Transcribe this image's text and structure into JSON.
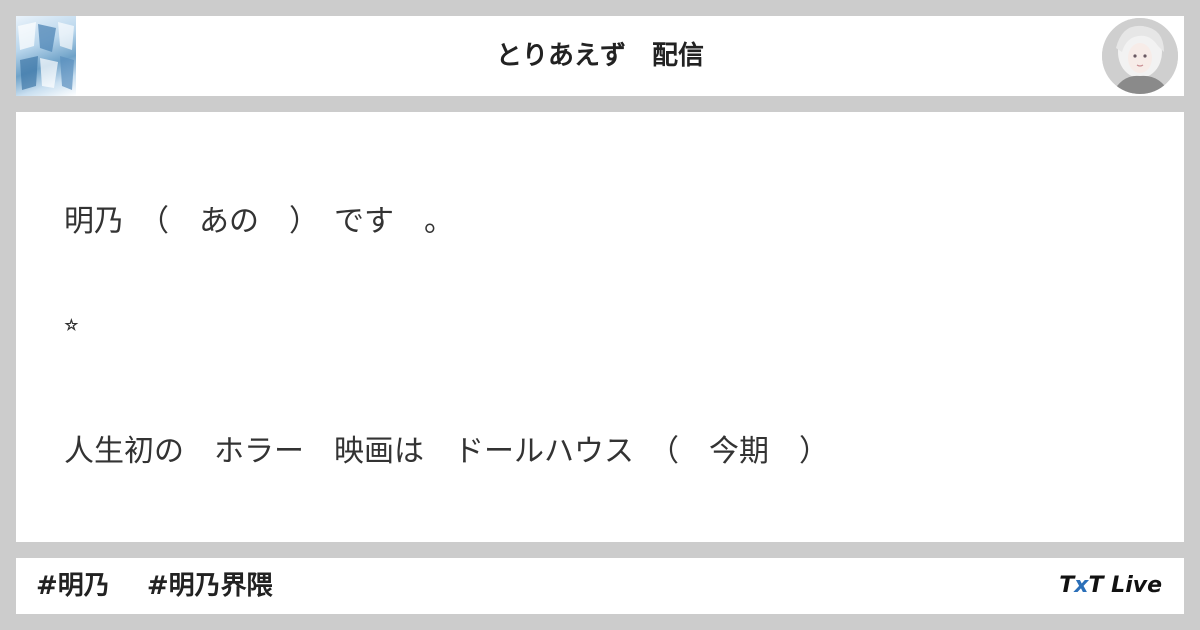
{
  "header": {
    "title": "とりあえず　配信",
    "thumbnail_icon": "stream-thumbnail-image",
    "avatar_icon": "user-avatar-image"
  },
  "body": {
    "lines": [
      "明乃　（　あの　）　です　。",
      "⭐︎",
      "人生初の　ホラー　映画は　ドールハウス　（　今期　）"
    ]
  },
  "footer": {
    "tags": [
      "#明乃",
      "#明乃界隈"
    ],
    "brand": {
      "part1": "T",
      "part2": "x",
      "part3": "T",
      "part4": " Live"
    },
    "accent_color": "#2b6fb8"
  }
}
